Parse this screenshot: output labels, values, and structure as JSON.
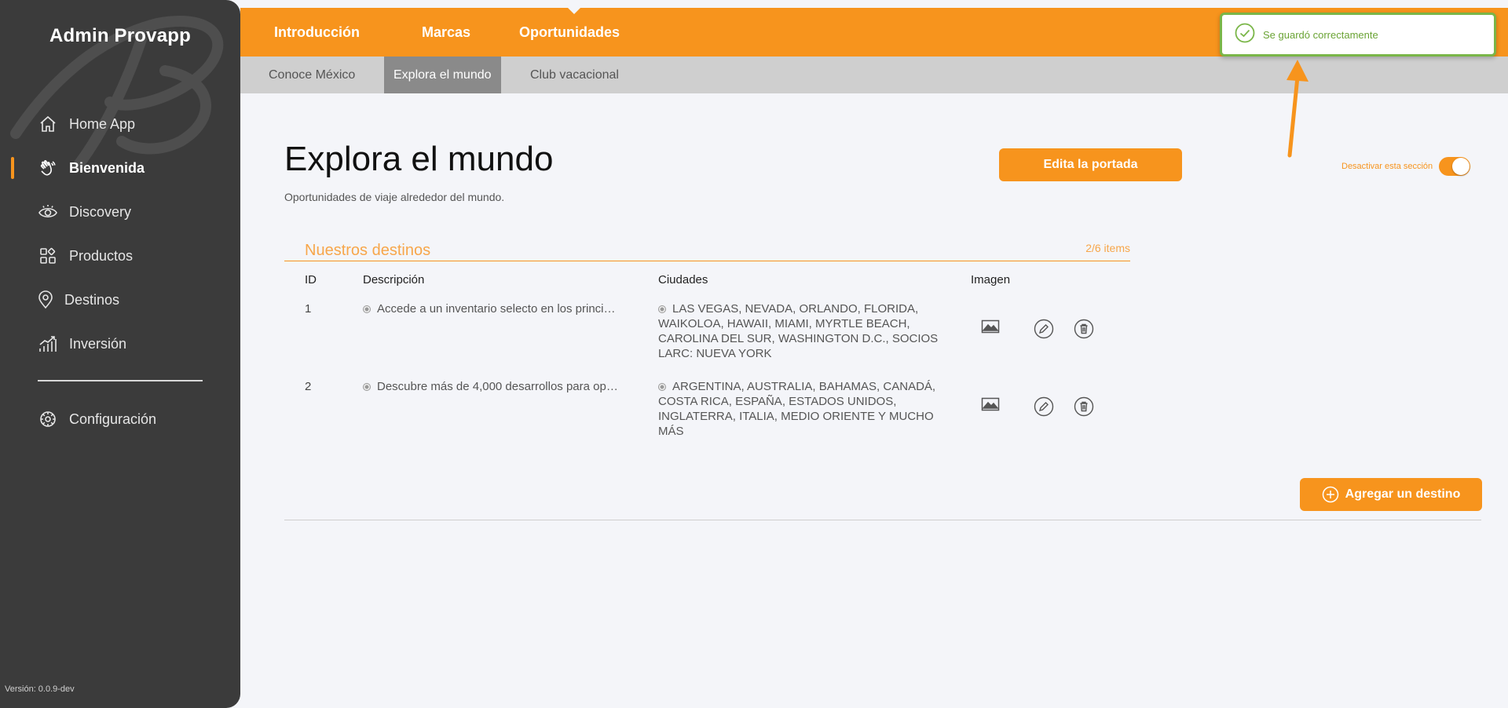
{
  "sidebar": {
    "brand": "Admin Provapp",
    "items": [
      {
        "label": "Home App",
        "icon": "home-icon"
      },
      {
        "label": "Bienvenida",
        "icon": "waving-hand-icon",
        "active": true
      },
      {
        "label": "Discovery",
        "icon": "eye-icon"
      },
      {
        "label": "Productos",
        "icon": "grid-icon"
      },
      {
        "label": "Destinos",
        "icon": "location-pin-icon"
      },
      {
        "label": "Inversión",
        "icon": "chart-growth-icon"
      }
    ],
    "config_label": "Configuración",
    "version": "Versión: 0.0.9-dev"
  },
  "topbar": {
    "tabs": [
      "Introducción",
      "Marcas",
      "Oportunidades"
    ],
    "active_tab": "Oportunidades"
  },
  "subbar": {
    "tabs": [
      "Conoce México",
      "Explora el mundo",
      "Club vacacional"
    ],
    "active_tab": "Explora el mundo"
  },
  "toast": {
    "message": "Se guardó correctamente"
  },
  "main": {
    "title": "Explora el mundo",
    "subtitle": "Oportunidades de viaje alrededor del mundo.",
    "edit_cover_button": "Edita la portada",
    "toggle_label": "Desactivar esta sección",
    "toggle_on": true
  },
  "destinos": {
    "title": "Nuestros destinos",
    "count": "2/6 items",
    "columns": [
      "ID",
      "Descripción",
      "Ciudades",
      "Imagen"
    ],
    "rows": [
      {
        "id": "1",
        "descripcion": "Accede a un inventario selecto en los princi…",
        "ciudades": [
          "LAS VEGAS, NEVADA, ORLANDO, FLORIDA,",
          "WAIKOLOA, HAWAII, MIAMI, MYRTLE BEACH,",
          "CAROLINA DEL SUR, WASHINGTON D.C., SOCIOS",
          "LARC: NUEVA YORK"
        ]
      },
      {
        "id": "2",
        "descripcion": "Descubre más de 4,000 desarrollos para op…",
        "ciudades": [
          "ARGENTINA, AUSTRALIA, BAHAMAS, CANADÁ,",
          "COSTA RICA, ESPAÑA, ESTADOS UNIDOS,",
          "INGLATERRA, ITALIA, MEDIO ORIENTE Y MUCHO",
          "MÁS"
        ]
      }
    ],
    "add_button": "Agregar un destino"
  },
  "colors": {
    "accent": "#f7941d",
    "sidebar": "#3b3b3b",
    "success": "#7ab648"
  }
}
